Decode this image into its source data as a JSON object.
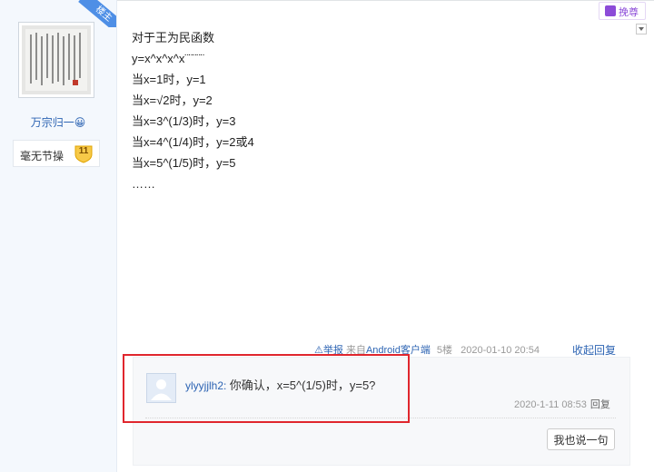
{
  "top_right": {
    "label": "挽尊"
  },
  "author": {
    "corner_tag": "楼主",
    "username": "万宗归一😀",
    "level_title": "毫无节操",
    "level_number": "11"
  },
  "post": {
    "lines": [
      "对于王为民函数",
      "y=x^x^x^x¨¨¨¨¨",
      "当x=1时，y=1",
      "当x=√2时，y=2",
      "当x=3^(1/3)时，y=3",
      "当x=4^(1/4)时，y=2或4",
      "当x=5^(1/5)时，y=5",
      "……"
    ],
    "meta": {
      "report": "⚠举报",
      "client_prefix": "来自",
      "client_name": "Android客户端",
      "floor": "5楼",
      "time": "2020-01-10 20:54"
    },
    "collapse_label": "收起回复"
  },
  "reply": {
    "user": "ylyyjjlh2",
    "separator": ":",
    "text": "你确认，x=5^(1/5)时，y=5?",
    "time": "2020-1-11 08:53",
    "reply_label": "回复"
  },
  "say_button": "我也说一句"
}
